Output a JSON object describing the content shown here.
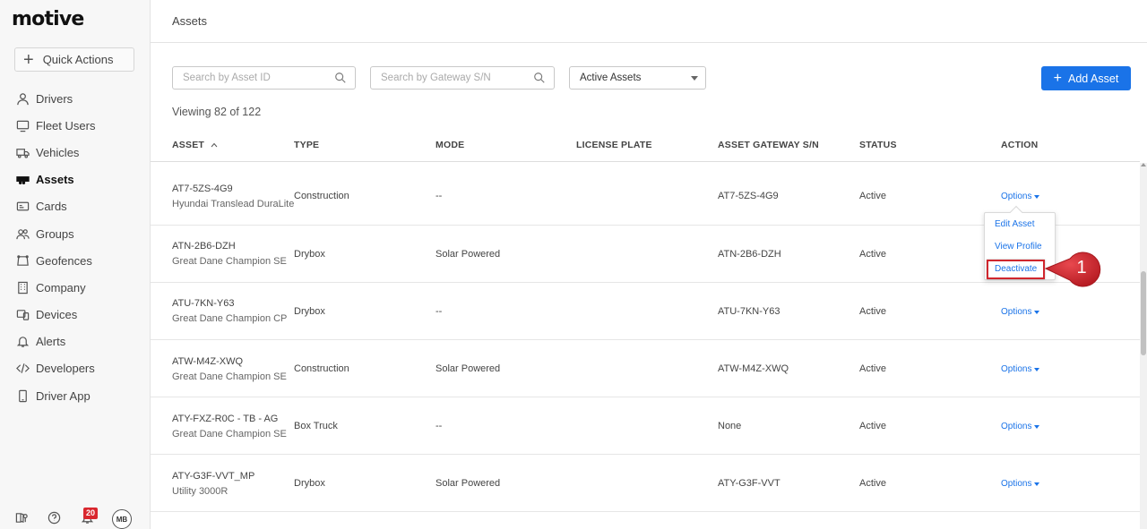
{
  "brand": {
    "logo": "motive"
  },
  "sidebar": {
    "quick_actions": "Quick Actions",
    "items": [
      {
        "label": "Drivers",
        "icon": "user-icon"
      },
      {
        "label": "Fleet Users",
        "icon": "monitor-icon"
      },
      {
        "label": "Vehicles",
        "icon": "truck-icon"
      },
      {
        "label": "Assets",
        "icon": "trailer-icon",
        "active": true
      },
      {
        "label": "Cards",
        "icon": "card-icon"
      },
      {
        "label": "Groups",
        "icon": "users-icon"
      },
      {
        "label": "Geofences",
        "icon": "geofence-icon"
      },
      {
        "label": "Company",
        "icon": "building-icon"
      },
      {
        "label": "Devices",
        "icon": "devices-icon"
      },
      {
        "label": "Alerts",
        "icon": "bell-icon"
      },
      {
        "label": "Developers",
        "icon": "code-icon"
      },
      {
        "label": "Driver App",
        "icon": "phone-icon"
      }
    ],
    "notification_count": "20",
    "avatar_initials": "MB"
  },
  "header": {
    "title": "Assets"
  },
  "toolbar": {
    "search_asset_placeholder": "Search by Asset ID",
    "search_gateway_placeholder": "Search by Gateway S/N",
    "filter_selected": "Active Assets",
    "add_button": "Add Asset"
  },
  "summary": {
    "viewing": "Viewing 82 of 122"
  },
  "table": {
    "columns": [
      "ASSET",
      "TYPE",
      "MODE",
      "LICENSE PLATE",
      "ASSET GATEWAY S/N",
      "STATUS",
      "ACTION"
    ],
    "rows": [
      {
        "asset_id": "AT7-5ZS-4G9",
        "model": "Hyundai Translead DuraLite",
        "type": "Construction",
        "mode": "--",
        "plate": "",
        "gateway": "AT7-5ZS-4G9",
        "status": "Active",
        "action": "Options"
      },
      {
        "asset_id": "ATN-2B6-DZH",
        "model": "Great Dane Champion SE",
        "type": "Drybox",
        "mode": "Solar Powered",
        "plate": "",
        "gateway": "ATN-2B6-DZH",
        "status": "Active",
        "action": ""
      },
      {
        "asset_id": "ATU-7KN-Y63",
        "model": "Great Dane Champion CP",
        "type": "Drybox",
        "mode": "--",
        "plate": "",
        "gateway": "ATU-7KN-Y63",
        "status": "Active",
        "action": "Options"
      },
      {
        "asset_id": "ATW-M4Z-XWQ",
        "model": "Great Dane Champion SE",
        "type": "Construction",
        "mode": "Solar Powered",
        "plate": "",
        "gateway": "ATW-M4Z-XWQ",
        "status": "Active",
        "action": "Options"
      },
      {
        "asset_id": "ATY-FXZ-R0C - TB - AG",
        "model": "Great Dane Champion SE",
        "type": "Box Truck",
        "mode": "--",
        "plate": "",
        "gateway": "None",
        "status": "Active",
        "action": "Options"
      },
      {
        "asset_id": "ATY-G3F-VVT_MP",
        "model": "Utility 3000R",
        "type": "Drybox",
        "mode": "Solar Powered",
        "plate": "",
        "gateway": "ATY-G3F-VVT",
        "status": "Active",
        "action": "Options"
      }
    ]
  },
  "dropdown": {
    "items": [
      "Edit Asset",
      "View Profile",
      "Deactivate"
    ]
  },
  "callout": {
    "number": "1"
  },
  "colors": {
    "accent": "#1a73e8",
    "callout": "#d0262d"
  }
}
